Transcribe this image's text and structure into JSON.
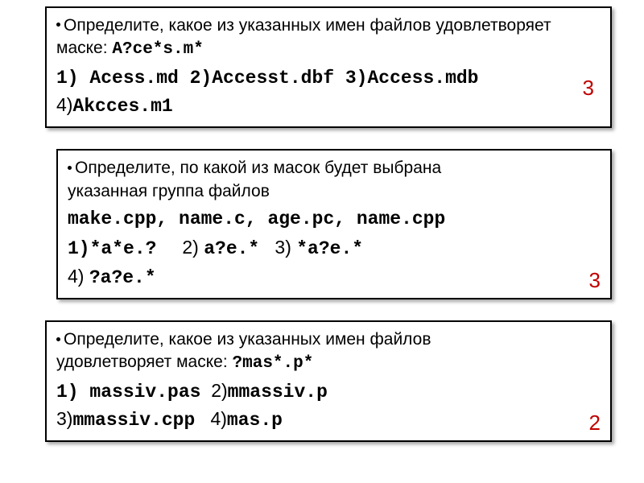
{
  "q1": {
    "line1": "Определите, какое из указанных имен файлов удовлетворяет",
    "line2_prefix": "маске: ",
    "mask": "A?ce*s.m*",
    "opt_row1": "1)  Acess.md  2)Accesst.dbf   3)Access.mdb",
    "opt_row2_num": " 4)",
    "opt_row2_m": "Akcces.m1",
    "answer": "3"
  },
  "q2": {
    "line1": "Определите, по какой из масок будет выбрана",
    "line2": "указанная группа файлов",
    "files": " make.cpp, name.c, age.pc, name.cpp",
    "opt_row1_a": "1)*a*e.?",
    "opt_row1_b": "a?e.*",
    "opt_row1_c": "*a?e.*",
    "n2": "2)",
    "n3": "3)",
    "opt_row2_num": " 4)",
    "opt_row2_m": "?a?e.*",
    "answer": "3"
  },
  "q3": {
    "line1": "Определите, какое из указанных имен файлов",
    "line2_prefix": "удовлетворяет маске: ",
    "mask": "?mas*.p*",
    "opt_row1_a": "1)  massiv.pas",
    "opt_row1_b": "mmassiv.p",
    "n2": "2)",
    "opt_row2_a": "mmassiv.cpp",
    "opt_row2_b": "mas.p",
    "n3": " 3)",
    "n4": "4)",
    "answer": "2"
  }
}
